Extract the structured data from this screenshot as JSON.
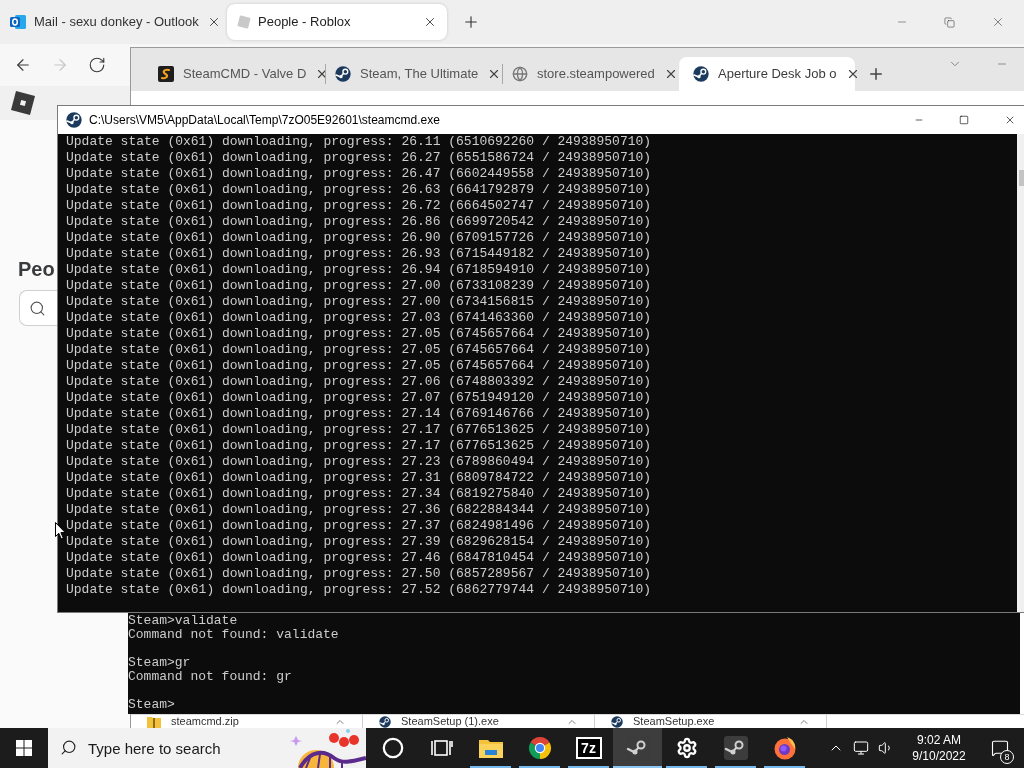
{
  "edge": {
    "tabs": [
      {
        "title": "Mail - sexu donkey - Outlook",
        "selected": false,
        "kind": "outlook"
      },
      {
        "title": "People - Roblox",
        "selected": true,
        "kind": "roblox"
      }
    ],
    "nav": [
      {
        "kind": "back",
        "disabled": false
      },
      {
        "kind": "forward",
        "disabled": true
      },
      {
        "kind": "refresh",
        "disabled": false
      }
    ],
    "page": {
      "heading": "Peo"
    }
  },
  "chrome": {
    "tabs": [
      {
        "title": "SteamCMD - Valve D",
        "selected": false,
        "kind": "steamcmd"
      },
      {
        "title": "Steam, The Ultimate",
        "selected": false,
        "kind": "steam"
      },
      {
        "title": "store.steampowered",
        "selected": false,
        "kind": "globe"
      },
      {
        "title": "Aperture Desk Job o",
        "selected": true,
        "kind": "steam"
      }
    ],
    "downloads": [
      {
        "name": "steamcmd.zip",
        "kind": "zip"
      },
      {
        "name": "SteamSetup (1).exe",
        "kind": "steam"
      },
      {
        "name": "SteamSetup.exe",
        "kind": "steam"
      }
    ]
  },
  "console": {
    "title": "C:\\Users\\VM5\\AppData\\Local\\Temp\\7zO05E92601\\steamcmd.exe",
    "lines": [
      "Update state (0x61) downloading, progress: 26.11 (6510692260 / 24938950710)",
      "Update state (0x61) downloading, progress: 26.27 (6551586724 / 24938950710)",
      "Update state (0x61) downloading, progress: 26.47 (6602449558 / 24938950710)",
      "Update state (0x61) downloading, progress: 26.63 (6641792879 / 24938950710)",
      "Update state (0x61) downloading, progress: 26.72 (6664502747 / 24938950710)",
      "Update state (0x61) downloading, progress: 26.86 (6699720542 / 24938950710)",
      "Update state (0x61) downloading, progress: 26.90 (6709157726 / 24938950710)",
      "Update state (0x61) downloading, progress: 26.93 (6715449182 / 24938950710)",
      "Update state (0x61) downloading, progress: 26.94 (6718594910 / 24938950710)",
      "Update state (0x61) downloading, progress: 27.00 (6733108239 / 24938950710)",
      "Update state (0x61) downloading, progress: 27.00 (6734156815 / 24938950710)",
      "Update state (0x61) downloading, progress: 27.03 (6741463360 / 24938950710)",
      "Update state (0x61) downloading, progress: 27.05 (6745657664 / 24938950710)",
      "Update state (0x61) downloading, progress: 27.05 (6745657664 / 24938950710)",
      "Update state (0x61) downloading, progress: 27.05 (6745657664 / 24938950710)",
      "Update state (0x61) downloading, progress: 27.06 (6748803392 / 24938950710)",
      "Update state (0x61) downloading, progress: 27.07 (6751949120 / 24938950710)",
      "Update state (0x61) downloading, progress: 27.14 (6769146766 / 24938950710)",
      "Update state (0x61) downloading, progress: 27.17 (6776513625 / 24938950710)",
      "Update state (0x61) downloading, progress: 27.17 (6776513625 / 24938950710)",
      "Update state (0x61) downloading, progress: 27.23 (6789860494 / 24938950710)",
      "Update state (0x61) downloading, progress: 27.31 (6809784722 / 24938950710)",
      "Update state (0x61) downloading, progress: 27.34 (6819275840 / 24938950710)",
      "Update state (0x61) downloading, progress: 27.36 (6822884344 / 24938950710)",
      "Update state (0x61) downloading, progress: 27.37 (6824981496 / 24938950710)",
      "Update state (0x61) downloading, progress: 27.39 (6829628154 / 24938950710)",
      "Update state (0x61) downloading, progress: 27.46 (6847810454 / 24938950710)",
      "Update state (0x61) downloading, progress: 27.50 (6857289567 / 24938950710)",
      "Update state (0x61) downloading, progress: 27.52 (6862779744 / 24938950710)"
    ]
  },
  "steam_console": {
    "blocks": [
      [
        "Steam>validate",
        "Command not found: validate"
      ],
      [
        "Steam>gr",
        "Command not found: gr"
      ],
      [
        "Steam>"
      ]
    ]
  },
  "taskbar": {
    "search": {
      "placeholder": "Type here to search"
    },
    "buttons": [
      {
        "kind": "cortana"
      },
      {
        "kind": "taskview"
      }
    ],
    "apps": [
      {
        "kind": "explorer",
        "running": true,
        "selected": false
      },
      {
        "kind": "chrome",
        "running": true,
        "selected": false
      },
      {
        "kind": "sevenzip",
        "label": "7z",
        "running": true,
        "selected": false
      },
      {
        "kind": "steam",
        "running": true,
        "selected": true
      },
      {
        "kind": "settings",
        "running": true,
        "selected": false
      },
      {
        "kind": "steam",
        "running": true,
        "selected": false
      },
      {
        "kind": "firefox",
        "running": true,
        "selected": false
      }
    ],
    "clock": {
      "time": "9:02 AM",
      "date": "9/10/2022"
    },
    "notifications": {
      "count": "8"
    }
  }
}
